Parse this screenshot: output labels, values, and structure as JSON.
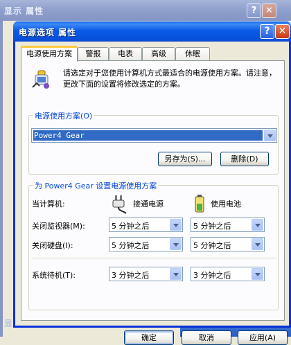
{
  "background_window": {
    "title": "显示 属性",
    "status_text": "显示 属性"
  },
  "dialog": {
    "title": "电源选项 属性",
    "help_glyph": "?",
    "close_glyph": "✕"
  },
  "tabs": [
    {
      "label": "电源使用方案"
    },
    {
      "label": "警报"
    },
    {
      "label": "电表"
    },
    {
      "label": "高级"
    },
    {
      "label": "休眠"
    }
  ],
  "intro": {
    "icon": "power-scheme-icon",
    "text": "请选定对于您使用计算机方式最适合的电源使用方案。请注意，更改下面的设置将修改选定的方案。"
  },
  "scheme_group": {
    "label": "电源使用方案(O)",
    "selected": "Power4 Gear",
    "save_as_label": "另存为(S)...",
    "delete_label": "删除(D)"
  },
  "settings_group": {
    "label": "为 Power4 Gear 设置电源使用方案",
    "computer_label": "当计算机:",
    "ac_label": "接通电源",
    "battery_label": "使用电池",
    "ac_icon": "power-plug-icon",
    "battery_icon": "battery-icon",
    "rows": [
      {
        "label": "关闭监视器(M):",
        "ac": "5 分钟之后",
        "battery": "5 分钟之后"
      },
      {
        "label": "关闭硬盘(I):",
        "ac": "5 分钟之后",
        "battery": "5 分钟之后"
      },
      {
        "label": "系统待机(T):",
        "ac": "3 分钟之后",
        "battery": "3 分钟之后"
      }
    ]
  },
  "footer": {
    "ok": "确定",
    "cancel": "取消",
    "apply": "应用(A)"
  },
  "colors": {
    "titlebar": "#0a5fec",
    "group_label": "#0046d5",
    "selection": "#316ac5",
    "active_tab_accent": "#ffc83c"
  }
}
